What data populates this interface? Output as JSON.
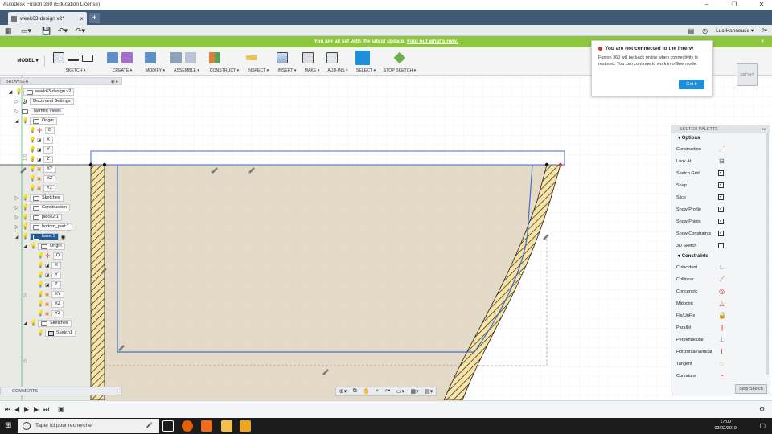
{
  "window": {
    "title": "Autodesk Fusion 360 (Education License)",
    "min": "–",
    "max": "❐",
    "close": "✕"
  },
  "tabs": {
    "doc_tab": "week63-design v2*",
    "close": "×",
    "new_tab": "+"
  },
  "quick": {
    "user": "Luc Hanneuse ▾",
    "help": "?▾"
  },
  "banner": {
    "text": "You are all set with the latest update.",
    "link": "Find out what's new.",
    "close": "×"
  },
  "toolbar": {
    "mode": "MODEL ▾",
    "groups": [
      "SKETCH ▾",
      "CREATE ▾",
      "MODIFY ▾",
      "ASSEMBLE ▾",
      "CONSTRUCT ▾",
      "INSPECT ▾",
      "INSERT ▾",
      "MAKE ▾",
      "ADD-INS ▾",
      "SELECT ▾",
      "STOP SKETCH ▾"
    ]
  },
  "notice": {
    "title": "You are not connected to the Interw",
    "body": "Fusion 360 will be back online when connectivity is restored. You can continue to work in offline mode.",
    "button": "Got it"
  },
  "viewcube": {
    "face": "FRONT"
  },
  "browser": {
    "title": "BROWSER",
    "nodes": [
      {
        "label": "week63-design v2"
      },
      {
        "label": "Document Settings"
      },
      {
        "label": "Named Views"
      },
      {
        "label": "Origin"
      },
      {
        "label": "O"
      },
      {
        "label": "X"
      },
      {
        "label": "Y"
      },
      {
        "label": "Z"
      },
      {
        "label": "XY"
      },
      {
        "label": "XZ"
      },
      {
        "label": "YZ"
      },
      {
        "label": "Sketches"
      },
      {
        "label": "Construction"
      },
      {
        "label": "piece2:1"
      },
      {
        "label": "bottom_part:1"
      },
      {
        "label": "base:1"
      },
      {
        "label": "Origin"
      },
      {
        "label": "O"
      },
      {
        "label": "X"
      },
      {
        "label": "Y"
      },
      {
        "label": "Z"
      },
      {
        "label": "XY"
      },
      {
        "label": "XZ"
      },
      {
        "label": "YZ"
      },
      {
        "label": "Sketches"
      },
      {
        "label": "Sketch1"
      }
    ]
  },
  "comments": {
    "label": "COMMENTS",
    "add": "+"
  },
  "palette": {
    "title": "SKETCH PALETTE",
    "options_header": "Options",
    "options": [
      {
        "label": "Construction",
        "icon": "construction-icon"
      },
      {
        "label": "Look At",
        "icon": "look-at-icon"
      },
      {
        "label": "Sketch Grid",
        "checked": true
      },
      {
        "label": "Snap",
        "checked": true
      },
      {
        "label": "Slice",
        "checked": true
      },
      {
        "label": "Show Profile",
        "checked": true
      },
      {
        "label": "Show Points",
        "checked": true
      },
      {
        "label": "Show Constraints",
        "checked": true
      },
      {
        "label": "3D Sketch",
        "checked": false
      }
    ],
    "constraints_header": "Constraints",
    "constraints": [
      {
        "label": "Coincident",
        "glyph": "∟",
        "color": "#888888"
      },
      {
        "label": "Collinear",
        "glyph": "⟋",
        "color": "#d9342b"
      },
      {
        "label": "Concentric",
        "glyph": "◎",
        "color": "#d9342b"
      },
      {
        "label": "Midpoint",
        "glyph": "△",
        "color": "#d9342b"
      },
      {
        "label": "Fix/UnFix",
        "glyph": "🔒",
        "color": "#d9342b"
      },
      {
        "label": "Parallel",
        "glyph": "∥",
        "color": "#d9342b"
      },
      {
        "label": "Perpendicular",
        "glyph": "⊥",
        "color": "#888888"
      },
      {
        "label": "Horizontal/Vertical",
        "glyph": "Ⅰ",
        "color": "#d9342b"
      },
      {
        "label": "Tangent",
        "glyph": "◌",
        "color": "#d9342b"
      },
      {
        "label": "Curvature",
        "glyph": "◔",
        "color": "#d9342b"
      }
    ],
    "stop": "Stop Sketch"
  },
  "taskbar": {
    "search": "Taper ici pour rechercher",
    "time": "17:00",
    "date": "03/02/2019"
  },
  "colors": {
    "accent": "#1f8fd9",
    "banner": "#8cc63e",
    "tabbar": "#405975",
    "profile": "#d9ceb6"
  }
}
